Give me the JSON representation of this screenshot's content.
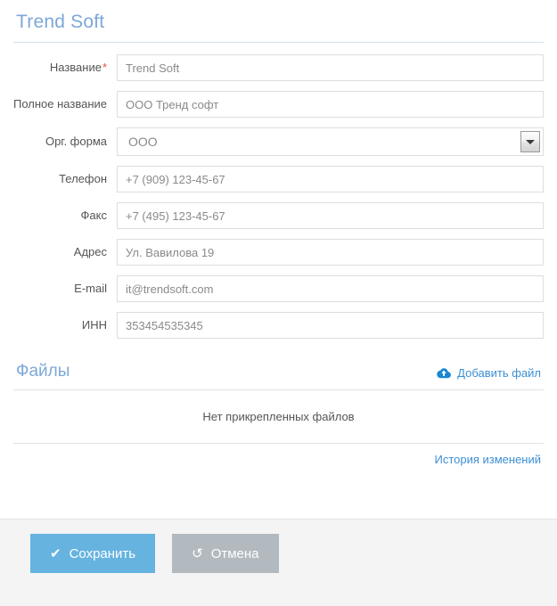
{
  "header": {
    "title": "Trend Soft"
  },
  "form": {
    "fields": [
      {
        "label": "Название",
        "required": true,
        "value": "Trend Soft",
        "type": "text",
        "name": "name"
      },
      {
        "label": "Полное название",
        "required": false,
        "value": "ООО Тренд софт",
        "type": "text",
        "name": "full-name"
      },
      {
        "label": "Орг. форма",
        "required": false,
        "value": "ООО",
        "type": "select",
        "name": "org-form"
      },
      {
        "label": "Телефон",
        "required": false,
        "value": "+7 (909) 123-45-67",
        "type": "text",
        "name": "phone"
      },
      {
        "label": "Факс",
        "required": false,
        "value": "+7 (495) 123-45-67",
        "type": "text",
        "name": "fax"
      },
      {
        "label": "Адрес",
        "required": false,
        "value": "Ул. Вавилова 19",
        "type": "text",
        "name": "address"
      },
      {
        "label": "E-mail",
        "required": false,
        "value": "it@trendsoft.com",
        "type": "text",
        "name": "email"
      },
      {
        "label": "ИНН",
        "required": false,
        "value": "353454535345",
        "type": "text",
        "name": "inn"
      }
    ],
    "required_marker": "*"
  },
  "files": {
    "title": "Файлы",
    "add_label": "Добавить файл",
    "add_icon": "cloud-upload-icon",
    "empty_text": "Нет прикрепленных файлов"
  },
  "history": {
    "link_label": "История изменений"
  },
  "footer": {
    "save_label": "Сохранить",
    "save_icon": "check-icon",
    "cancel_label": "Отмена",
    "cancel_icon": "undo-icon"
  },
  "colors": {
    "accent": "#7da7d9",
    "link": "#3d8fd4",
    "save_button": "#66b3e0",
    "cancel_button": "#b2bac0",
    "required": "#e8503a",
    "footer_bg": "#f4f4f4"
  }
}
